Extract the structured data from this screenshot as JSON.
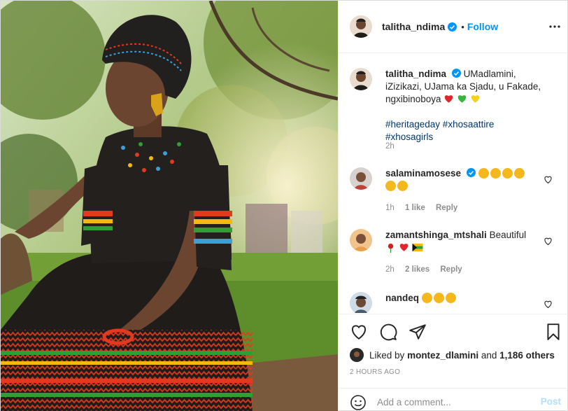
{
  "post": {
    "author": "talitha_ndima",
    "follow_dot": "•",
    "follow_label": "Follow"
  },
  "caption": {
    "username": "talitha_ndima",
    "text": "UMadlamini, iZizikazi, UJama ka Sjadu, u Fakade, ngxibinoboya",
    "hashtags": "#heritageday #xhosaattire #xhosagirls",
    "time": "2h"
  },
  "comments": [
    {
      "username": "salaminamosese",
      "text": "",
      "time": "1h",
      "likes": "1 like",
      "reply": "Reply"
    },
    {
      "username": "zamantshinga_mtshali",
      "text": "Beautiful",
      "time": "2h",
      "likes": "2 likes",
      "reply": "Reply"
    },
    {
      "username": "nandeq",
      "text": ""
    }
  ],
  "likes": {
    "prefix": "Liked by",
    "user": "montez_dlamini",
    "and": "and",
    "others": "1,186 others"
  },
  "timestamp": "2 HOURS AGO",
  "comment_box": {
    "placeholder": "Add a comment...",
    "post_label": "Post"
  },
  "icons": [
    "more-options-icon",
    "heart-icon",
    "comment-icon",
    "share-icon",
    "bookmark-icon",
    "emoji-icon",
    "verified-badge-icon"
  ],
  "colors": {
    "accent": "#0095f6",
    "hashtag": "#00376b",
    "muted": "#8e8e8e",
    "post_disabled": "#b2dffc",
    "like_red": "#ed4956"
  }
}
